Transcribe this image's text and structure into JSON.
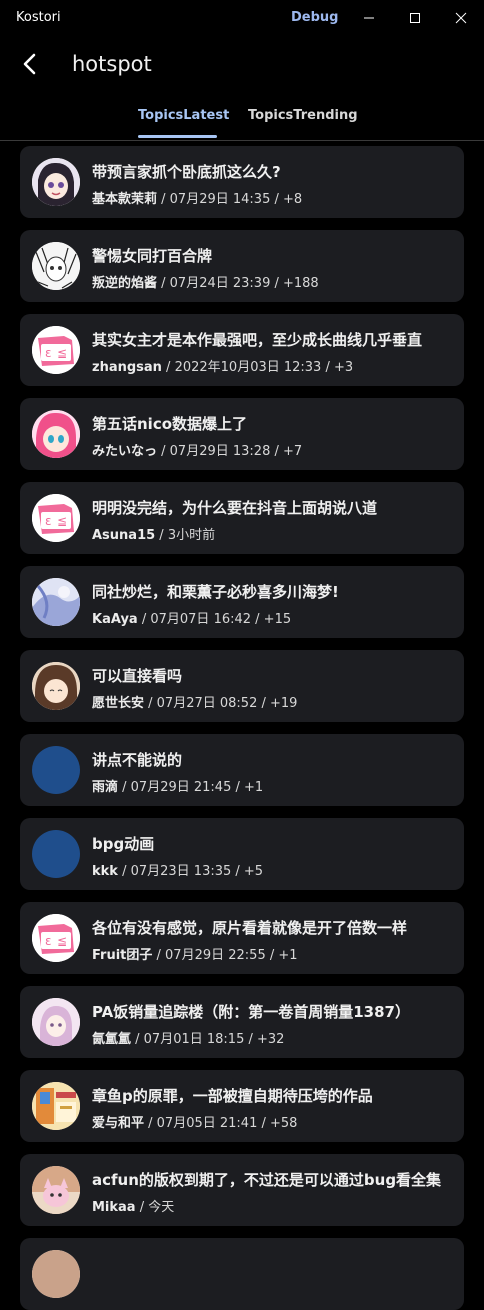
{
  "window": {
    "app_name": "Kostori",
    "debug_label": "Debug"
  },
  "header": {
    "title": "hotspot"
  },
  "tabs": [
    {
      "label": "TopicsLatest",
      "active": true
    },
    {
      "label": "TopicsTrending",
      "active": false
    }
  ],
  "topics": [
    {
      "title": "带预言家抓个卧底抓这么久?",
      "author": "基本款茉莉",
      "meta": " / 07月29日 14:35 / +8",
      "avatar": "anime-avatar"
    },
    {
      "title": "警惕女同打百合牌",
      "author": "叛逆的焰酱",
      "meta": " / 07月24日 23:39 / +188",
      "avatar": "manga-avatar"
    },
    {
      "title": "其实女主才是本作最强吧，至少成长曲线几乎垂直",
      "author": "zhangsan",
      "meta": " / 2022年10月03日 12:33 / +3",
      "avatar": "pink-default-avatar"
    },
    {
      "title": "第五话nico数据爆上了",
      "author": "みたいなっ",
      "meta": " / 07月29日 13:28 / +7",
      "avatar": "pink-hair-avatar"
    },
    {
      "title": "明明没完结，为什么要在抖音上面胡说八道",
      "author": "Asuna15",
      "meta": " / 3小时前",
      "avatar": "pink-default-avatar"
    },
    {
      "title": "同社炒烂，和栗薫子必秒喜多川海梦!",
      "author": "KaAya",
      "meta": " / 07月07日 16:42 / +15",
      "avatar": "blue-art-avatar"
    },
    {
      "title": "可以直接看吗",
      "author": "愿世长安",
      "meta": " / 07月27日 08:52 / +19",
      "avatar": "brown-hair-avatar"
    },
    {
      "title": "讲点不能说的",
      "author": "雨滴",
      "meta": " / 07月29日 21:45 / +1",
      "avatar": "blue-circle-avatar"
    },
    {
      "title": "bpg动画",
      "author": "kkk",
      "meta": " / 07月23日 13:35 / +5",
      "avatar": "blue-circle-avatar"
    },
    {
      "title": "各位有没有感觉，原片看着就像是开了倍数一样",
      "author": "Fruit团子",
      "meta": " / 07月29日 22:55 / +1",
      "avatar": "pink-default-avatar"
    },
    {
      "title": "PA饭销量追踪楼（附：第一卷首周销量1387）",
      "author": "氤氲氲",
      "meta": " / 07月01日 18:15 / +32",
      "avatar": "pastel-avatar"
    },
    {
      "title": "章鱼p的原罪，一部被擅自期待压垮的作品",
      "author": "爱与和平",
      "meta": " / 07月05日 21:41 / +58",
      "avatar": "poster-avatar"
    },
    {
      "title": "acfun的版权到期了，不过还是可以通过bug看全集",
      "author": "Mikaa",
      "meta": " / 今天",
      "avatar": "cat-avatar"
    }
  ]
}
